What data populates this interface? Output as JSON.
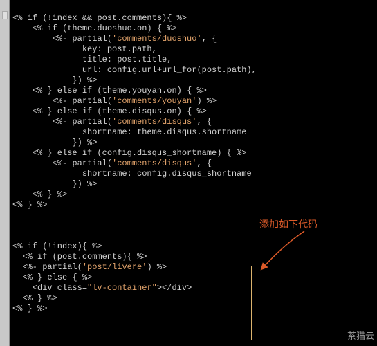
{
  "code": {
    "l0": "<% if (!index && post.comments){ %>",
    "l1": "    <% if (theme.duoshuo.on) { %>",
    "l2a": "        <%- partial(",
    "l2b": "'comments/duoshuo'",
    "l2c": ", {",
    "l3": "              key: post.path,",
    "l4": "              title: post.title,",
    "l5": "              url: config.url+url_for(post.path),",
    "l6": "            }) %>",
    "l7": "    <% } else if (theme.youyan.on) { %>",
    "l8a": "        <%- partial(",
    "l8b": "'comments/youyan'",
    "l8c": ") %>",
    "l9": "    <% } else if (theme.disqus.on) { %>",
    "l10a": "        <%- partial(",
    "l10b": "'comments/disqus'",
    "l10c": ", {",
    "l11": "              shortname: theme.disqus.shortname",
    "l12": "            }) %>",
    "l13": "    <% } else if (config.disqus_shortname) { %>",
    "l14a": "        <%- partial(",
    "l14b": "'comments/disqus'",
    "l14c": ", {",
    "l15": "              shortname: config.disqus_shortname",
    "l16": "            }) %>",
    "l17": "    <% } %>",
    "l18": "<% } %>",
    "l19": "",
    "l20": "",
    "l21": "",
    "l22": "<% if (!index){ %>",
    "l23": "  <% if (post.comments){ %>",
    "l24a": "  <%- partial(",
    "l24b": "'post/livere'",
    "l24c": ") %>",
    "l25": "  <% } else { %>",
    "l26a": "    <div class=",
    "l26b": "\"lv-container\"",
    "l26c": "></div>",
    "l27": "  <% } %>",
    "l28": "<% } %>"
  },
  "annotation": "添加如下代码",
  "watermark": "茶猫云"
}
